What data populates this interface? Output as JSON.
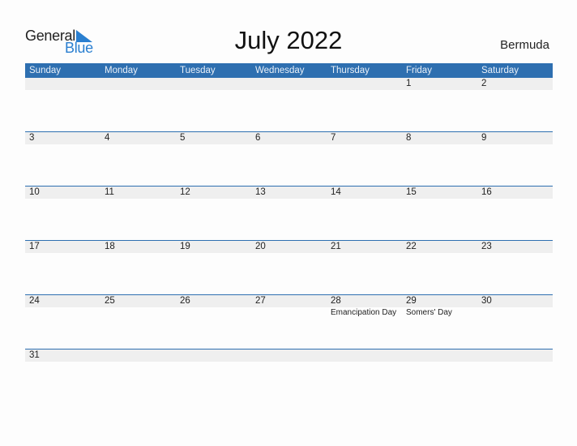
{
  "logo": {
    "word1": "General",
    "word2": "Blue"
  },
  "title": "July 2022",
  "country": "Bermuda",
  "weekdays": [
    "Sunday",
    "Monday",
    "Tuesday",
    "Wednesday",
    "Thursday",
    "Friday",
    "Saturday"
  ],
  "weeks": [
    [
      {
        "day": ""
      },
      {
        "day": ""
      },
      {
        "day": ""
      },
      {
        "day": ""
      },
      {
        "day": ""
      },
      {
        "day": "1"
      },
      {
        "day": "2"
      }
    ],
    [
      {
        "day": "3"
      },
      {
        "day": "4"
      },
      {
        "day": "5"
      },
      {
        "day": "6"
      },
      {
        "day": "7"
      },
      {
        "day": "8"
      },
      {
        "day": "9"
      }
    ],
    [
      {
        "day": "10"
      },
      {
        "day": "11"
      },
      {
        "day": "12"
      },
      {
        "day": "13"
      },
      {
        "day": "14"
      },
      {
        "day": "15"
      },
      {
        "day": "16"
      }
    ],
    [
      {
        "day": "17"
      },
      {
        "day": "18"
      },
      {
        "day": "19"
      },
      {
        "day": "20"
      },
      {
        "day": "21"
      },
      {
        "day": "22"
      },
      {
        "day": "23"
      }
    ],
    [
      {
        "day": "24"
      },
      {
        "day": "25"
      },
      {
        "day": "26"
      },
      {
        "day": "27"
      },
      {
        "day": "28",
        "event": "Emancipation Day"
      },
      {
        "day": "29",
        "event": "Somers' Day"
      },
      {
        "day": "30"
      }
    ],
    [
      {
        "day": "31"
      },
      {
        "day": ""
      },
      {
        "day": ""
      },
      {
        "day": ""
      },
      {
        "day": ""
      },
      {
        "day": ""
      },
      {
        "day": ""
      }
    ]
  ],
  "colors": {
    "header": "#2e6fb0",
    "accent": "#2a7fd0",
    "dayband": "#efefef"
  }
}
